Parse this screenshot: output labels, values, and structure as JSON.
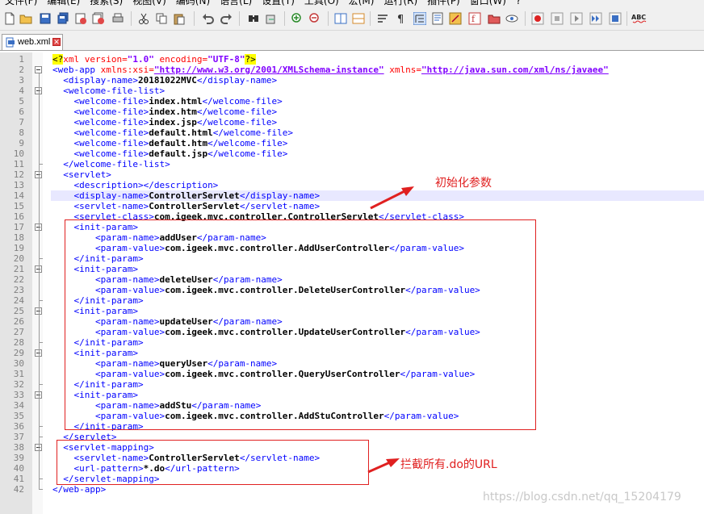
{
  "menu": [
    "文件(F)",
    "编辑(E)",
    "搜索(S)",
    "视图(V)",
    "编码(N)",
    "语言(L)",
    "设置(T)",
    "工具(O)",
    "宏(M)",
    "运行(R)",
    "插件(P)",
    "窗口(W)",
    "?"
  ],
  "tab": {
    "name": "web.xml",
    "close_icon": "close-icon"
  },
  "annotations": {
    "init_params": "初始化参数",
    "intercept": "拦截所有.do的URL"
  },
  "watermark": "https://blog.csdn.net/qq_15204179",
  "lines": [
    "1",
    "2",
    "3",
    "4",
    "5",
    "6",
    "7",
    "8",
    "9",
    "10",
    "11",
    "12",
    "13",
    "14",
    "15",
    "16",
    "17",
    "18",
    "19",
    "20",
    "21",
    "22",
    "23",
    "24",
    "25",
    "26",
    "27",
    "28",
    "29",
    "30",
    "31",
    "32",
    "33",
    "34",
    "35",
    "36",
    "37",
    "38",
    "39",
    "40",
    "41",
    "42"
  ],
  "code": {
    "xml_decl": {
      "open": "<?",
      "body_pre": "xml version=",
      "version": "\"1.0\"",
      "mid": " encoding=",
      "encoding": "\"UTF-8\"",
      "close": "?>"
    },
    "webapp_open": {
      "tag": "<web-app",
      "attr1": " xmlns:xsi=",
      "val1": "\"http://www.w3.org/2001/XMLSchema-instance\"",
      "attr2": " xmlns=",
      "val2": "\"http://java.sun.com/xml/ns/javaee\""
    },
    "display_name": {
      "open": "<display-name>",
      "text": "20181022MVC",
      "close": "</display-name>"
    },
    "welcome_open": "<welcome-file-list>",
    "welcome_files": [
      "index.html",
      "index.htm",
      "index.jsp",
      "default.html",
      "default.htm",
      "default.jsp"
    ],
    "wf_open": "<welcome-file>",
    "wf_close": "</welcome-file>",
    "welcome_close": "</welcome-file-list>",
    "servlet_open": "<servlet>",
    "description": "<description></description>",
    "servlet_display": {
      "open": "<display-name>",
      "text": "ControllerServlet",
      "close": "</display-name>"
    },
    "servlet_name": {
      "open": "<servlet-name>",
      "text": "ControllerServlet",
      "close": "</servlet-name>"
    },
    "servlet_class": {
      "open": "<servlet-class>",
      "text": "com.igeek.mvc.controller.ControllerServlet",
      "close": "</servlet-class>"
    },
    "init_open": "<init-param>",
    "init_close": "</init-param>",
    "pn_open": "<param-name>",
    "pn_close": "</param-name>",
    "pv_open": "<param-value>",
    "pv_close": "</param-value>",
    "params": [
      {
        "name": "addUser",
        "value": "com.igeek.mvc.controller.AddUserController"
      },
      {
        "name": "deleteUser",
        "value": "com.igeek.mvc.controller.DeleteUserController"
      },
      {
        "name": "updateUser",
        "value": "com.igeek.mvc.controller.UpdateUserController"
      },
      {
        "name": "queryUser",
        "value": "com.igeek.mvc.controller.QueryUserController"
      },
      {
        "name": "addStu",
        "value": "com.igeek.mvc.controller.AddStuController"
      }
    ],
    "servlet_close": "</servlet>",
    "mapping_open": "<servlet-mapping>",
    "mapping_name": {
      "open": "<servlet-name>",
      "text": "ControllerServlet",
      "close": "</servlet-name>"
    },
    "url_pattern": {
      "open": "<url-pattern>",
      "text": "*.do",
      "close": "</url-pattern>"
    },
    "mapping_close": "</servlet-mapping>",
    "webapp_close": "</web-app>"
  },
  "colors": {
    "tag": "#0000ff",
    "attr": "#ff0000",
    "value": "#8000ff",
    "annotation": "#e02020",
    "current_line": "#e8e8ff"
  }
}
